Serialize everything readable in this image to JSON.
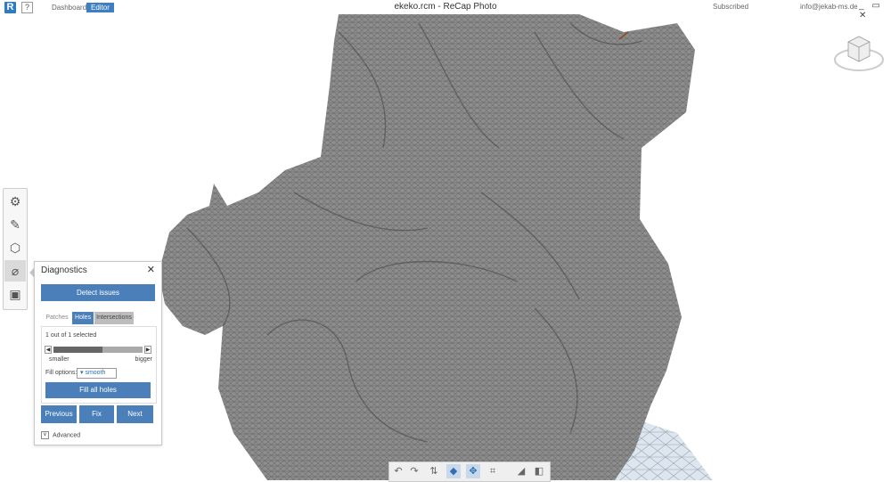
{
  "app": {
    "logo": "R",
    "help": "?",
    "title": "ekeko.rcm - ReCap Photo",
    "nav": {
      "dashboard": "Dashboard",
      "editor": "Editor"
    },
    "subscription": "Subscribed",
    "user": "info@jekab-ms.de",
    "window_buttons": "_ ▭ ✕"
  },
  "toolstrip": {
    "icons": [
      "settings-icon",
      "pencil-icon",
      "polyhedron-icon",
      "ruler-icon",
      "frame-icon"
    ],
    "glyphs": [
      "⚙",
      "✎",
      "⬡",
      "⌀",
      "▣"
    ],
    "active_index": 3
  },
  "diagnostics": {
    "title": "Diagnostics",
    "close": "✕",
    "detect_label": "Detect issues",
    "tabs": [
      "Patches",
      "Holes",
      "Intersections"
    ],
    "active_tab": "Holes",
    "count_text": "1 out of 1 selected",
    "slider_left": "◀",
    "slider_right": "▶",
    "slider_fill": 0.55,
    "smaller": "smaller",
    "bigger": "bigger",
    "fill_options_label": "Fill options:",
    "fill_option_value": "▾ smooth",
    "fill_all_label": "Fill all holes",
    "previous_label": "Previous",
    "fix_label": "Fix",
    "next_label": "Next",
    "advanced_label": "Advanced",
    "advanced_check": "∨"
  },
  "bottom_toolbar": {
    "icons": [
      "undo-icon",
      "redo-icon",
      "adjust-icon",
      "shaded-cube-icon",
      "orbit-icon",
      "crop-icon",
      "section-icon",
      "sound-icon"
    ],
    "glyphs": [
      "↶",
      "↷",
      "⇅",
      "◆",
      "✥",
      "⌗",
      "◢",
      "◧"
    ],
    "active_indices": [
      3,
      4
    ]
  },
  "colors": {
    "accent": "#4a7fb9",
    "mesh": "#8a8a8a",
    "mesh_dark": "#5a5a5a"
  }
}
